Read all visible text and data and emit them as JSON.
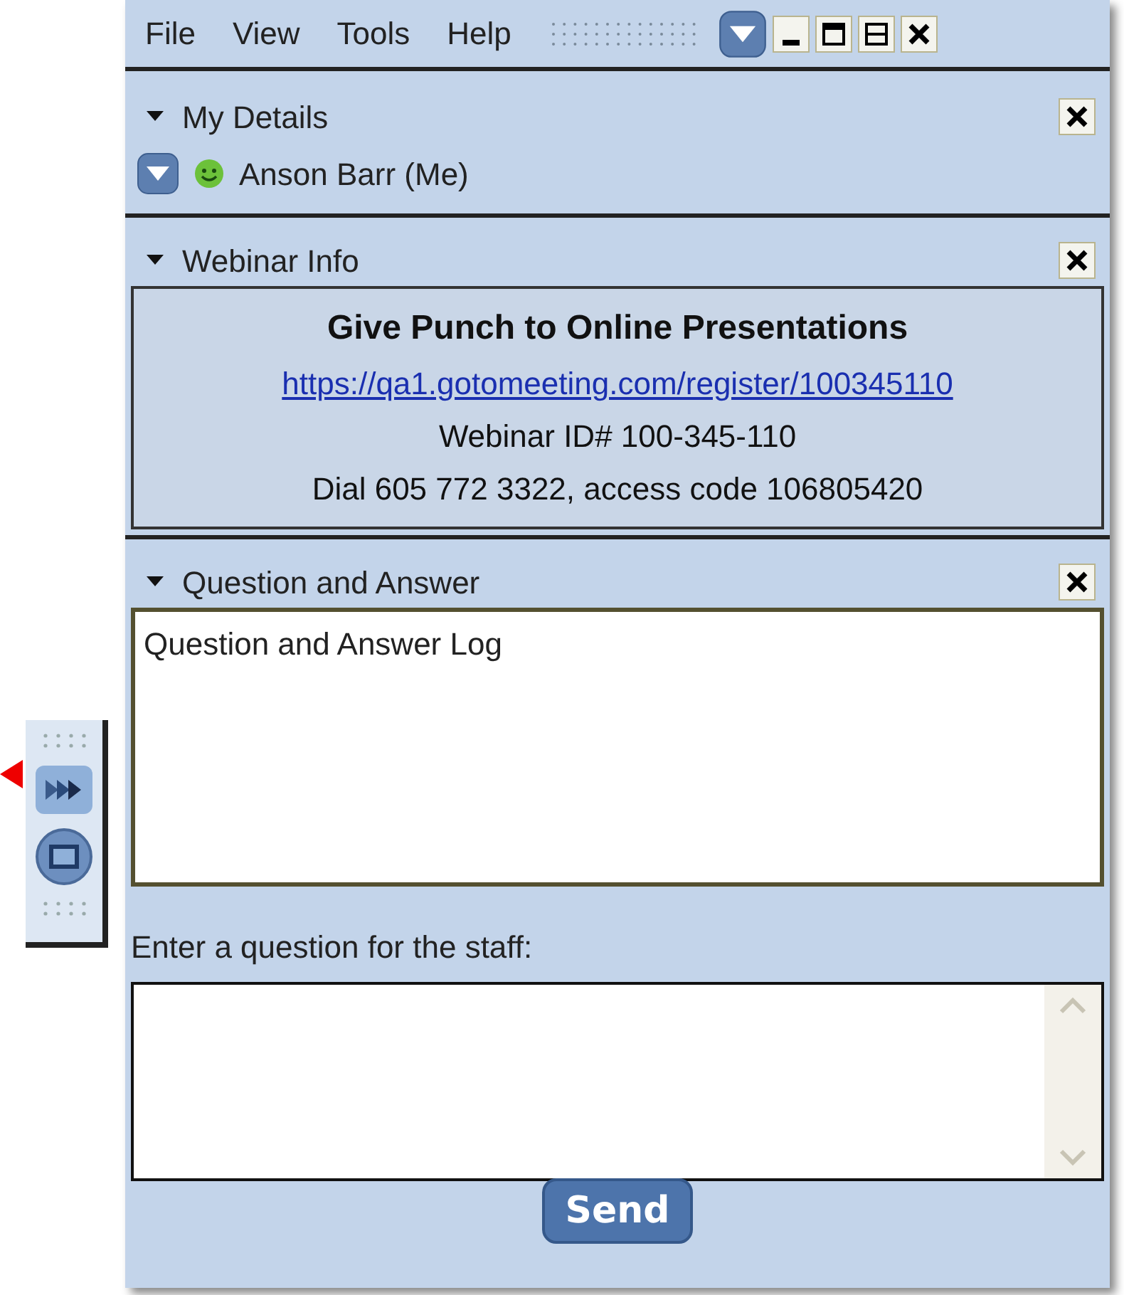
{
  "menu": [
    {
      "label": "File"
    },
    {
      "label": "View"
    },
    {
      "label": "Tools"
    },
    {
      "label": "Help"
    }
  ],
  "my_details": {
    "title": "My Details",
    "expanded": true,
    "user": "Anson Barr (Me)"
  },
  "webinar_info": {
    "title": "Webinar Info",
    "expanded": true,
    "heading": "Give Punch to Online Presentations",
    "link": "https://qa1.gotomeeting.com/register/100345110",
    "webinar_id": "Webinar ID# 100-345-110",
    "dial": "Dial 605 772 3322, access code 106805420"
  },
  "qa": {
    "title": "Question and Answer",
    "expanded": true,
    "log": "Question and Answer Log",
    "prompt": "Enter a question for the staff:",
    "send": "Send"
  }
}
